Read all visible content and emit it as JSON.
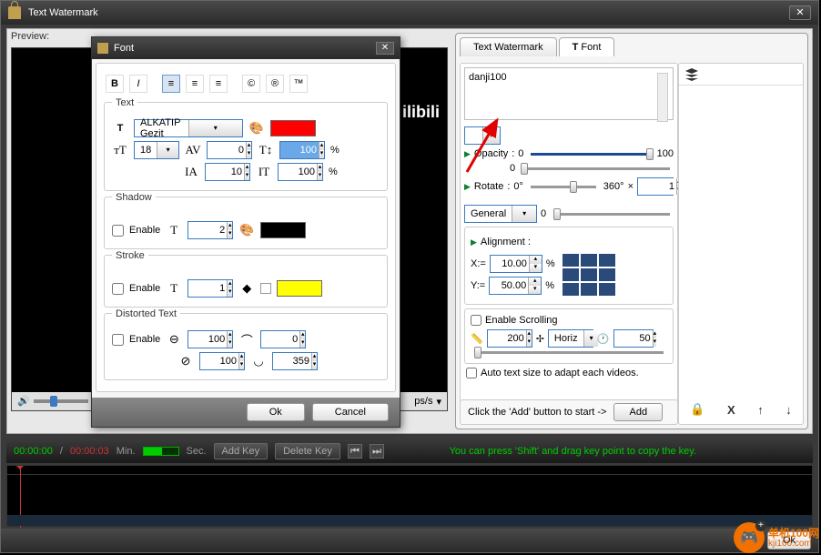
{
  "window": {
    "title": "Text Watermark",
    "preview_label": "Preview:"
  },
  "preview_sample_text": "ilibili",
  "font_dialog": {
    "title": "Font",
    "format_buttons": {
      "bold": "B",
      "italic": "I",
      "align_left": "≡",
      "align_center": "≡",
      "align_right": "≡",
      "copyright": "©",
      "registered": "®",
      "trademark": "™"
    },
    "groups": {
      "text": {
        "title": "Text",
        "font_family": "ALKATIP Gezit",
        "font_size": "18",
        "char_spacing": "0",
        "line_height_input1": "100",
        "line_spacing": "10",
        "baseline": "100",
        "color": "#ff0000"
      },
      "shadow": {
        "title": "Shadow",
        "enable_label": "Enable",
        "offset": "2",
        "color": "#000000"
      },
      "stroke": {
        "title": "Stroke",
        "enable_label": "Enable",
        "width": "1",
        "color": "#ffff00"
      },
      "distorted": {
        "title": "Distorted Text",
        "enable_label": "Enable",
        "a": "100",
        "b": "0",
        "c": "100",
        "d": "359"
      }
    },
    "ok": "Ok",
    "cancel": "Cancel"
  },
  "right_panel": {
    "tabs": {
      "text_wm": "Text Watermark",
      "font": "Font"
    },
    "text_value": "danji100",
    "opacity": {
      "label": "Opacity",
      "from": "0",
      "to": "100",
      "value": "0"
    },
    "rotate": {
      "label": "Rotate",
      "from": "0°",
      "to": "360°",
      "mult": "×",
      "value": "1"
    },
    "general": {
      "label": "General",
      "slider": "0"
    },
    "alignment": {
      "label": "Alignment :",
      "x_label": "X:=",
      "x": "10.00",
      "y_label": "Y:=",
      "y": "50.00",
      "pct": "%"
    },
    "scrolling": {
      "enable": "Enable Scrolling",
      "width": "200",
      "dir": "Horiz",
      "speed": "50"
    },
    "auto_size": "Auto text size to adapt each videos.",
    "add_hint": "Click the 'Add' button to start ->",
    "add_btn": "Add",
    "side_actions": {
      "lock": "🔒",
      "del": "X",
      "up": "↑",
      "down": "↓"
    }
  },
  "keyframe_bar": {
    "t1": "00:00:00",
    "sep": "/",
    "t2": "00:00:03",
    "min": "Min.",
    "sec": "Sec.",
    "add": "Add Key",
    "del": "Delete Key",
    "hint": "You can press 'Shift' and drag key point to copy the key."
  },
  "bottom": {
    "ok": "Ok"
  },
  "playback_label": "ps/s",
  "site_watermark": {
    "name": "单机100网",
    "url": "kji100.com"
  }
}
